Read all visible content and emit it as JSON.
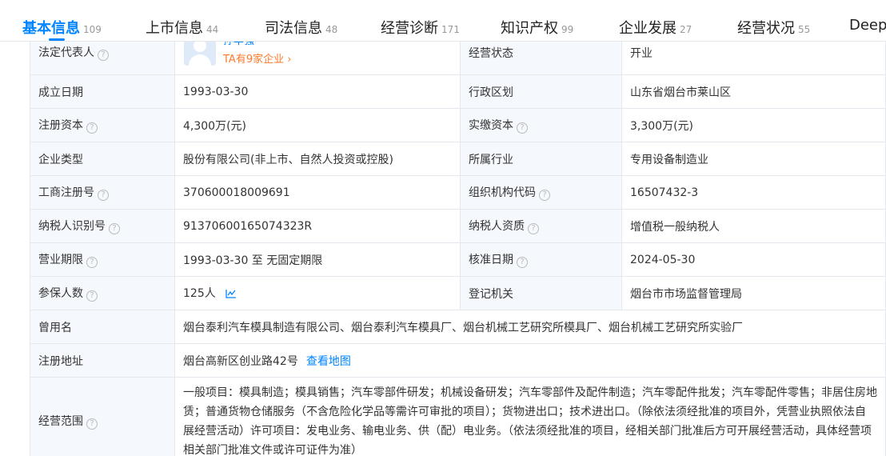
{
  "tabs": [
    {
      "label": "基本信息",
      "count": "109"
    },
    {
      "label": "上市信息",
      "count": "44"
    },
    {
      "label": "司法信息",
      "count": "48"
    },
    {
      "label": "经营诊断",
      "count": "171"
    },
    {
      "label": "知识产权",
      "count": "99"
    },
    {
      "label": "企业发展",
      "count": "27"
    },
    {
      "label": "经营状况",
      "count": "55"
    },
    {
      "label": "Deep",
      "count": ""
    }
  ],
  "rows": {
    "legal_rep": {
      "label": "法定代表人",
      "name": "孙丰强",
      "link": "TA有9家企业"
    },
    "status": {
      "label": "经营状态",
      "value": "开业"
    },
    "founded": {
      "label": "成立日期",
      "value": "1993-03-30"
    },
    "region": {
      "label": "行政区划",
      "value": "山东省烟台市莱山区"
    },
    "reg_capital": {
      "label": "注册资本",
      "value": "4,300万(元)"
    },
    "paid_capital": {
      "label": "实缴资本",
      "value": "3,300万(元)"
    },
    "type": {
      "label": "企业类型",
      "value": "股份有限公司(非上市、自然人投资或控股)"
    },
    "industry": {
      "label": "所属行业",
      "value": "专用设备制造业"
    },
    "reg_no": {
      "label": "工商注册号",
      "value": "370600018009691"
    },
    "org_code": {
      "label": "组织机构代码",
      "value": "16507432-3"
    },
    "tax_id": {
      "label": "纳税人识别号",
      "value": "91370600165074323R"
    },
    "tax_qual": {
      "label": "纳税人资质",
      "value": "增值税一般纳税人"
    },
    "term": {
      "label": "营业期限",
      "value": "1993-03-30 至 无固定期限"
    },
    "approved": {
      "label": "核准日期",
      "value": "2024-05-30"
    },
    "insured": {
      "label": "参保人数",
      "value": "125人"
    },
    "authority": {
      "label": "登记机关",
      "value": "烟台市市场监督管理局"
    },
    "former": {
      "label": "曾用名",
      "value": "烟台泰利汽车模具制造有限公司、烟台泰利汽车模具厂、烟台机械工艺研究所模具厂、烟台机械工艺研究所实验厂"
    },
    "address": {
      "label": "注册地址",
      "value": "烟台高新区创业路42号",
      "link": "查看地图"
    },
    "scope": {
      "label": "经营范围",
      "lines": [
        "一般项目：模具制造；模具销售；汽车零部件研发；机械设备研发；汽车零部件及配件制造；汽车零配件批发；汽车零配件零售；非居住房地",
        "赁；普通货物仓储服务（不含危险化学品等需许可审批的项目）；货物进出口；技术进出口。（除依法须经批准的项目外，凭营业执照依法自",
        "展经营活动）许可项目：发电业务、输电业务、供（配）电业务。（依法须经批准的项目，经相关部门批准后方可开展经营活动，具体经营项",
        "相关部门批准文件或许可证件为准）"
      ]
    }
  },
  "colors": {
    "accent": "#0084ff",
    "orange": "#ff7a29",
    "label_bg": "#f5f8fc",
    "border": "#e4e8ee"
  }
}
